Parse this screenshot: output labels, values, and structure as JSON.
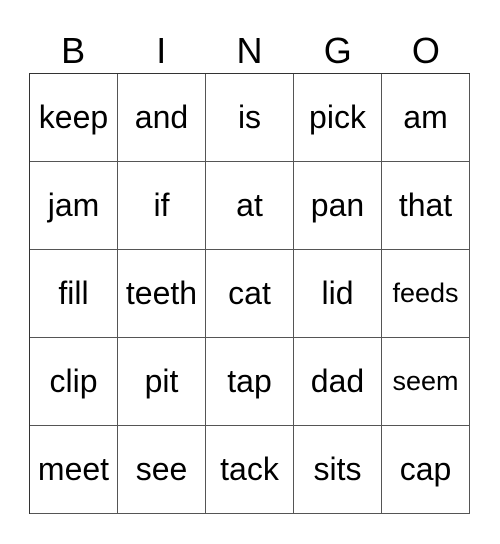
{
  "card": {
    "header": [
      "B",
      "I",
      "N",
      "G",
      "O"
    ],
    "rows": [
      [
        "keep",
        "and",
        "is",
        "pick",
        "am"
      ],
      [
        "jam",
        "if",
        "at",
        "pan",
        "that"
      ],
      [
        "fill",
        "teeth",
        "cat",
        "lid",
        "feeds"
      ],
      [
        "clip",
        "pit",
        "tap",
        "dad",
        "seem"
      ],
      [
        "meet",
        "see",
        "tack",
        "sits",
        "cap"
      ]
    ]
  }
}
